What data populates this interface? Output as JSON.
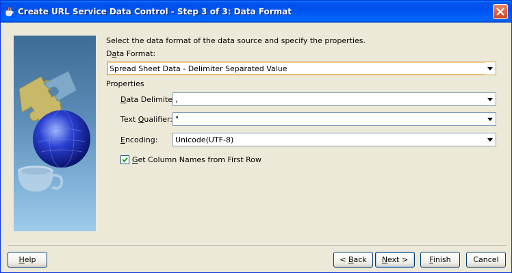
{
  "window": {
    "title": "Create URL Service Data Control  - Step 3 of 3: Data Format",
    "close_icon": "close-x-icon",
    "title_icon": "coffee-cup-icon"
  },
  "banner": {
    "icons": [
      "puzzle-piece-icon",
      "globe-icon",
      "coffee-cup-icon"
    ]
  },
  "main": {
    "instruction": "Select the data format of the data source and specify the properties.",
    "data_format_label_pre": "D",
    "data_format_label_u": "a",
    "data_format_label_post": "ta Format:",
    "data_format_value": "Spread Sheet Data - Delimiter Separated Value",
    "properties_label": "Properties",
    "delimiter": {
      "label_pre": "",
      "label_u": "D",
      "label_post": "ata Delimiter:",
      "value": ","
    },
    "qualifier": {
      "label_pre": "Text ",
      "label_u": "Q",
      "label_post": "ualifier:",
      "value": "\""
    },
    "encoding": {
      "label_pre": "",
      "label_u": "E",
      "label_post": "ncoding:",
      "value": "Unicode(UTF-8)"
    },
    "column_names": {
      "label_pre": "",
      "label_u": "G",
      "label_post": "et Column Names from First Row",
      "checked": true
    }
  },
  "footer": {
    "help": {
      "pre": "",
      "u": "H",
      "post": "elp"
    },
    "back": {
      "pre": "< ",
      "u": "B",
      "post": "ack"
    },
    "next": {
      "pre": "",
      "u": "N",
      "post": "ext >"
    },
    "finish": {
      "pre": "",
      "u": "F",
      "post": "inish"
    },
    "cancel": {
      "pre": "Cancel",
      "u": "",
      "post": ""
    }
  }
}
